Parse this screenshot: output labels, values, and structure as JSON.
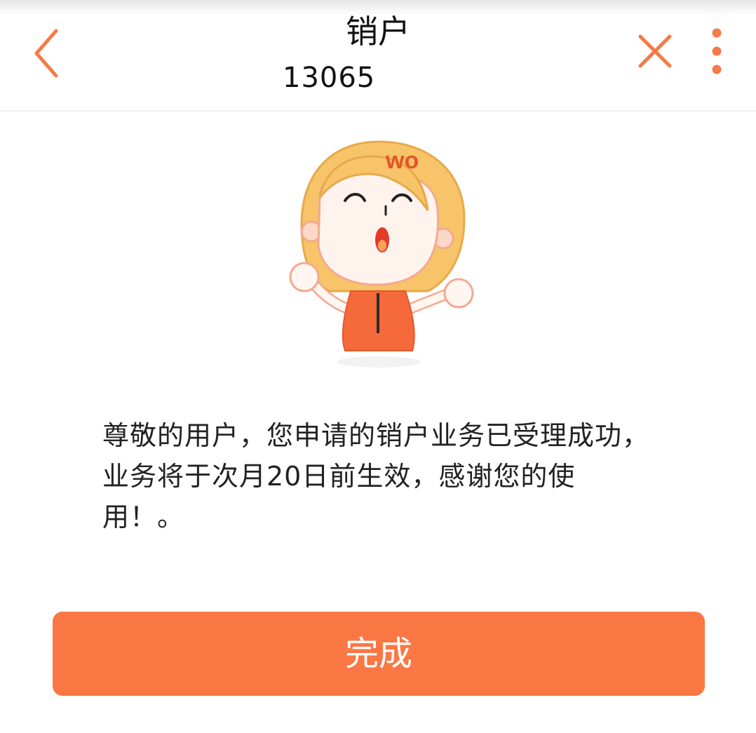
{
  "header": {
    "title": "销户",
    "phone_number": "13065",
    "back_icon": "chevron-left-icon",
    "close_icon": "close-icon",
    "more_icon": "more-vertical-icon",
    "accent_color": "#f57a45"
  },
  "mascot": {
    "logo_text": "wo",
    "icon": "mascot-girl-illustration"
  },
  "main": {
    "message": "尊敬的用户，您申请的销户业务已受理成功，业务将于次月20日前生效，感谢您的使用！。"
  },
  "footer": {
    "done_label": "完成",
    "button_color": "#fb7743"
  }
}
